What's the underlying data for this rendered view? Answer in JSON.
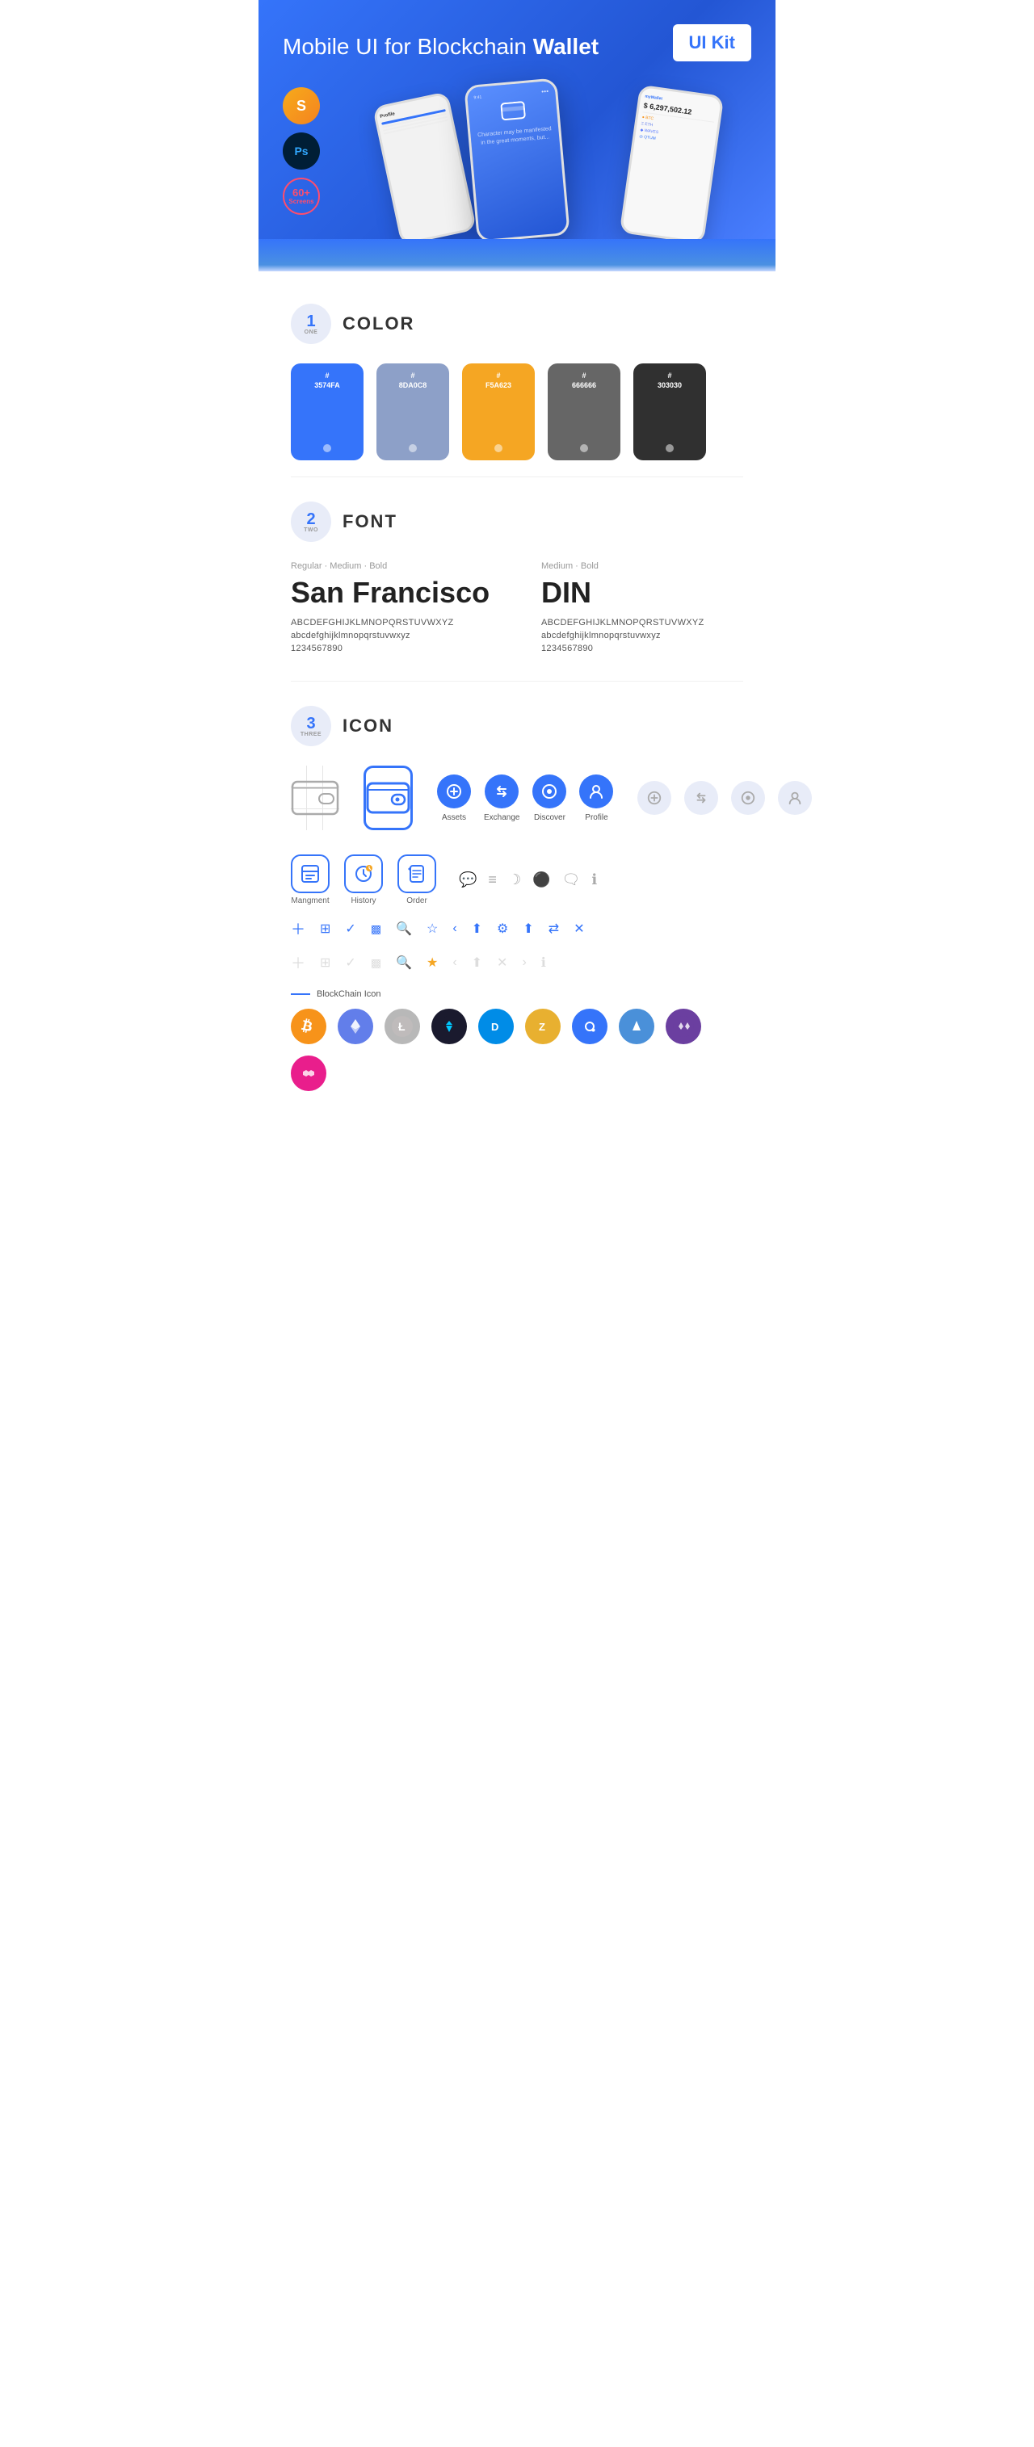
{
  "hero": {
    "title": "Mobile UI for Blockchain ",
    "title_bold": "Wallet",
    "badge": "UI Kit",
    "badges": [
      {
        "id": "sketch",
        "label": "S"
      },
      {
        "id": "ps",
        "label": "Ps"
      },
      {
        "id": "screens",
        "num": "60+",
        "text": "Screens"
      }
    ]
  },
  "color_section": {
    "number": "1",
    "number_word": "ONE",
    "title": "COLOR",
    "swatches": [
      {
        "hex": "#3574FA",
        "label": "#\n3574FA",
        "bg": "#3574FA"
      },
      {
        "hex": "#8DA0C8",
        "label": "#\n8DA0C8",
        "bg": "#8DA0C8"
      },
      {
        "hex": "#F5A623",
        "label": "#\nF5A623",
        "bg": "#F5A623"
      },
      {
        "hex": "#666666",
        "label": "#\n666666",
        "bg": "#666666"
      },
      {
        "hex": "#303030",
        "label": "#\n303030",
        "bg": "#303030"
      }
    ]
  },
  "font_section": {
    "number": "2",
    "number_word": "TWO",
    "title": "FONT",
    "fonts": [
      {
        "type": "Regular · Medium · Bold",
        "name": "San Francisco",
        "upper": "ABCDEFGHIJKLMNOPQRSTUVWXYZ",
        "lower": "abcdefghijklmnopqrstuvwxyz",
        "nums": "1234567890"
      },
      {
        "type": "Medium · Bold",
        "name": "DIN",
        "upper": "ABCDEFGHIJKLMNOPQRSTUVWXYZ",
        "lower": "abcdefghijklmnopqrstuvwxyz",
        "nums": "1234567890"
      }
    ]
  },
  "icon_section": {
    "number": "3",
    "number_word": "THREE",
    "title": "ICON",
    "nav_icons": [
      {
        "label": "Assets",
        "active": true
      },
      {
        "label": "Exchange",
        "active": true
      },
      {
        "label": "Discover",
        "active": true
      },
      {
        "label": "Profile",
        "active": true
      }
    ],
    "bottom_icons": [
      {
        "label": "Mangment"
      },
      {
        "label": "History"
      },
      {
        "label": "Order"
      }
    ]
  },
  "blockchain": {
    "label": "BlockChain Icon",
    "coins": [
      {
        "symbol": "₿",
        "bg": "#F7931A",
        "name": "Bitcoin"
      },
      {
        "symbol": "Ξ",
        "bg": "#627EEA",
        "name": "Ethereum"
      },
      {
        "symbol": "Ł",
        "bg": "#B8B8B8",
        "name": "Litecoin"
      },
      {
        "symbol": "◈",
        "bg": "#1A1A2E",
        "name": "Stratis"
      },
      {
        "symbol": "D",
        "bg": "#008CE7",
        "name": "Dash"
      },
      {
        "symbol": "Z",
        "bg": "#E8B030",
        "name": "Zcash"
      },
      {
        "symbol": "◎",
        "bg": "#3574FA",
        "name": "Qtum"
      },
      {
        "symbol": "▲",
        "bg": "#3574FA",
        "name": "Augur"
      },
      {
        "symbol": "◇",
        "bg": "#6B3FA0",
        "name": "Nano"
      },
      {
        "symbol": "∞",
        "bg": "#E91E8C",
        "name": "Polygon"
      }
    ]
  }
}
